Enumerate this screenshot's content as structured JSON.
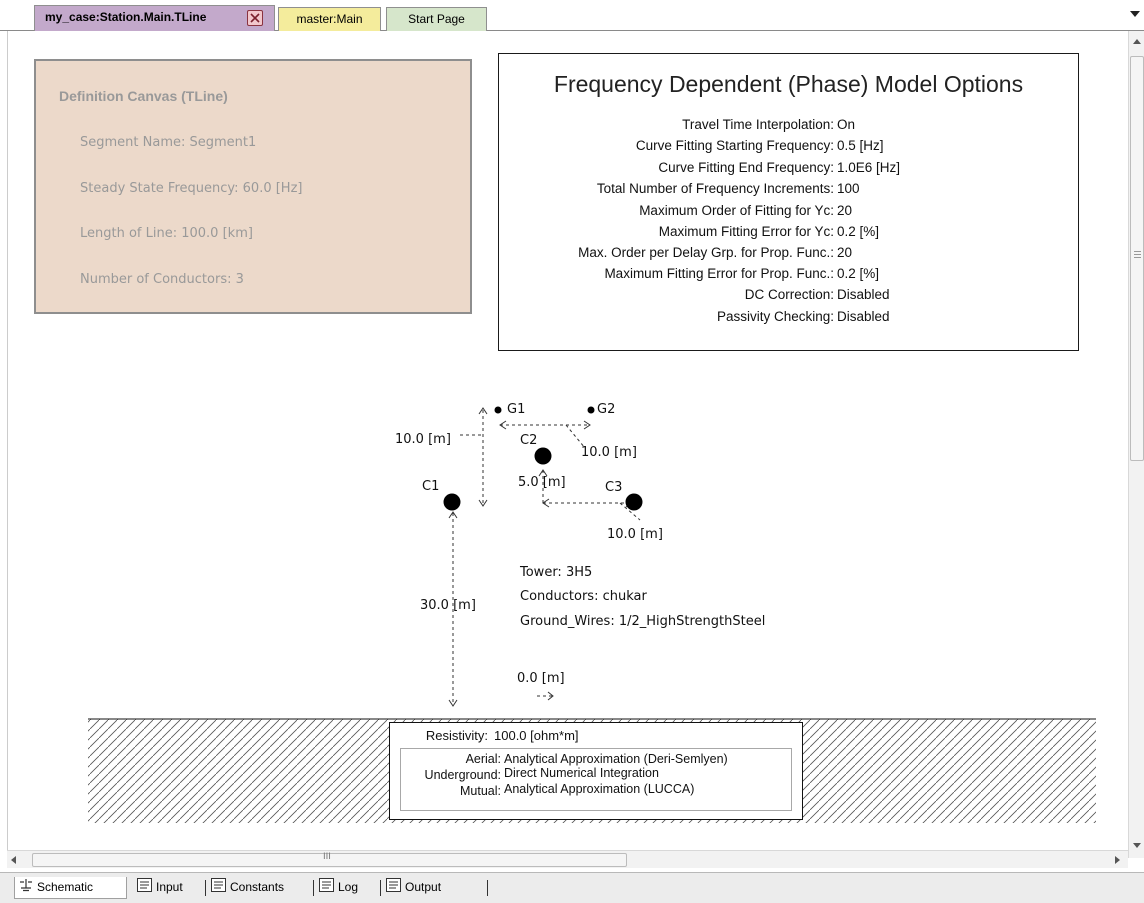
{
  "tabs": [
    {
      "label": "my_case:Station.Main.TLine"
    },
    {
      "label": "master:Main"
    },
    {
      "label": "Start Page"
    }
  ],
  "definition_canvas": {
    "title": "Definition Canvas (TLine)",
    "segment_name": "Segment Name: Segment1",
    "steady_state_frequency": "Steady State Frequency: 60.0 [Hz]",
    "length_of_line": "Length of Line: 100.0 [km]",
    "number_of_conductors": "Number of Conductors: 3"
  },
  "model_options": {
    "title": "Frequency Dependent (Phase) Model Options",
    "rows": [
      {
        "label": "Travel Time Interpolation:",
        "value": "On"
      },
      {
        "label": "Curve Fitting Starting Frequency:",
        "value": "0.5 [Hz]"
      },
      {
        "label": "Curve Fitting End Frequency:",
        "value": "1.0E6 [Hz]"
      },
      {
        "label": "Total Number of Frequency Increments:",
        "value": "100"
      },
      {
        "label": "Maximum Order of Fitting for Yc:",
        "value": "20"
      },
      {
        "label": "Maximum Fitting Error for Yc:",
        "value": "0.2 [%]"
      },
      {
        "label": "Max. Order per Delay Grp. for Prop. Func.:",
        "value": "20"
      },
      {
        "label": "Maximum Fitting Error for Prop. Func.:",
        "value": "0.2 [%]"
      },
      {
        "label": "DC Correction:",
        "value": "Disabled"
      },
      {
        "label": "Passivity Checking:",
        "value": "Disabled"
      }
    ]
  },
  "tower_diagram": {
    "g1_label": "G1",
    "g2_label": "G2",
    "c1_label": "C1",
    "c2_label": "C2",
    "c3_label": "C3",
    "dim_g_vertical": "10.0 [m]",
    "dim_g_horizontal": "10.0 [m]",
    "dim_c2_c3_vertical": "5.0 [m]",
    "dim_c3_horizontal": "10.0 [m]",
    "dim_c1_height": "30.0 [m]",
    "dim_offset": "0.0 [m]",
    "tower": "Tower: 3H5",
    "conductors": "Conductors: chukar",
    "ground_wires": "Ground_Wires: 1/2_HighStrengthSteel"
  },
  "ground": {
    "resistivity_label": "Resistivity:",
    "resistivity_value": "100.0 [ohm*m]",
    "aerial_label": "Aerial:",
    "aerial_value": "Analytical Approximation (Deri-Semlyen)",
    "underground_label": "Underground:",
    "underground_value": "Direct Numerical Integration",
    "mutual_label": "Mutual:",
    "mutual_value": "Analytical Approximation (LUCCA)"
  },
  "scroll": {
    "grip": "III"
  },
  "bottom_tabs": [
    {
      "label": "Schematic",
      "icon": "schematic-icon"
    },
    {
      "label": "Input",
      "icon": "document-icon"
    },
    {
      "label": "Constants",
      "icon": "document-icon"
    },
    {
      "label": "Log",
      "icon": "document-icon"
    },
    {
      "label": "Output",
      "icon": "document-icon"
    }
  ]
}
